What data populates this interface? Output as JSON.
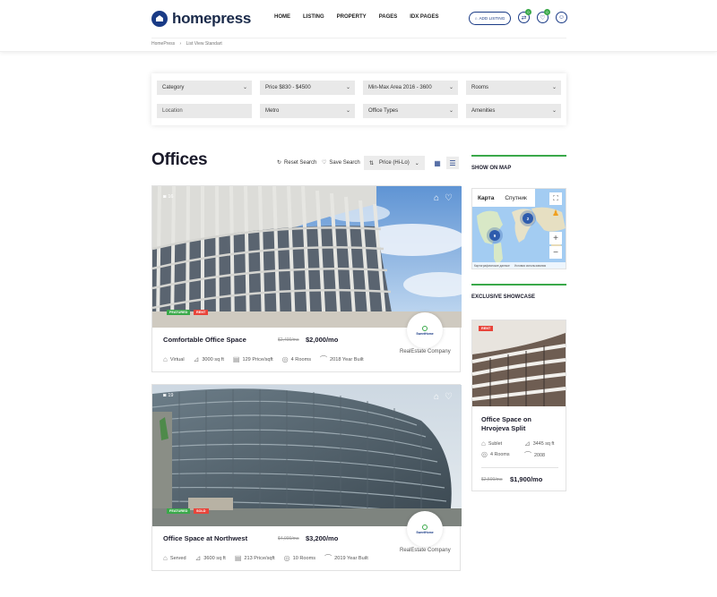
{
  "header": {
    "logo_text": "homepress",
    "nav": [
      "HOME",
      "LISTING",
      "PROPERTY",
      "PAGES",
      "IDX PAGES"
    ],
    "add_listing": "ADD LISTING",
    "compare_count": "0",
    "favorites_count": "0"
  },
  "breadcrumb": {
    "home": "HomePress",
    "sep": "›",
    "current": "List View Standart"
  },
  "filters": {
    "category": "Category",
    "price": "Price $830 - $4500",
    "area": "Min-Max Area 2016 - 3600",
    "rooms": "Rooms",
    "location": "Location",
    "metro": "Metro",
    "office_types": "Office Types",
    "amenities": "Amenities"
  },
  "page": {
    "title": "Offices",
    "reset_search": "Reset Search",
    "save_search": "Save Search",
    "sort": "Price (Hi-Lo)"
  },
  "listings": [
    {
      "photos": "16",
      "tags": [
        "FEATURED",
        "RENT"
      ],
      "title": "Comfortable Office Space",
      "old_price": "$2,400/mo",
      "price": "$2,000/mo",
      "features": [
        "Virtual",
        "3000 sq ft",
        "129 Price/sqft",
        "4 Rooms",
        "2018 Year Built"
      ],
      "agency": "RealEstate Company",
      "agency_logo": "SweetHome"
    },
    {
      "photos": "19",
      "tags": [
        "FEATURED",
        "SOLD"
      ],
      "title": "Office Space at Northwest",
      "old_price": "$4,000/mo",
      "price": "$3,200/mo",
      "features": [
        "Served",
        "3600 sq ft",
        "213 Price/sqft",
        "10 Rooms",
        "2019 Year Built"
      ],
      "agency": "RealEstate Company",
      "agency_logo": "SweetHome"
    }
  ],
  "sidebar": {
    "map_heading": "SHOW ON MAP",
    "map_tab_map": "Карта",
    "map_tab_sat": "Спутник",
    "cluster_a": "2",
    "cluster_b": "9",
    "map_footer_a": "Картографические данные",
    "map_footer_b": "Условия использования",
    "showcase_heading": "EXCLUSIVE SHOWCASE",
    "showcase": {
      "tag": "RENT",
      "title": "Office Space on Hrvojeva Split",
      "type": "Sublet",
      "area": "3445 sq ft",
      "rooms": "4 Rooms",
      "year": "2008",
      "old_price": "$2,500/mo",
      "price": "$1,900/mo"
    }
  },
  "colors": {
    "brand": "#1a3b86",
    "accent": "#3aa94a",
    "sold": "#e8443a"
  }
}
